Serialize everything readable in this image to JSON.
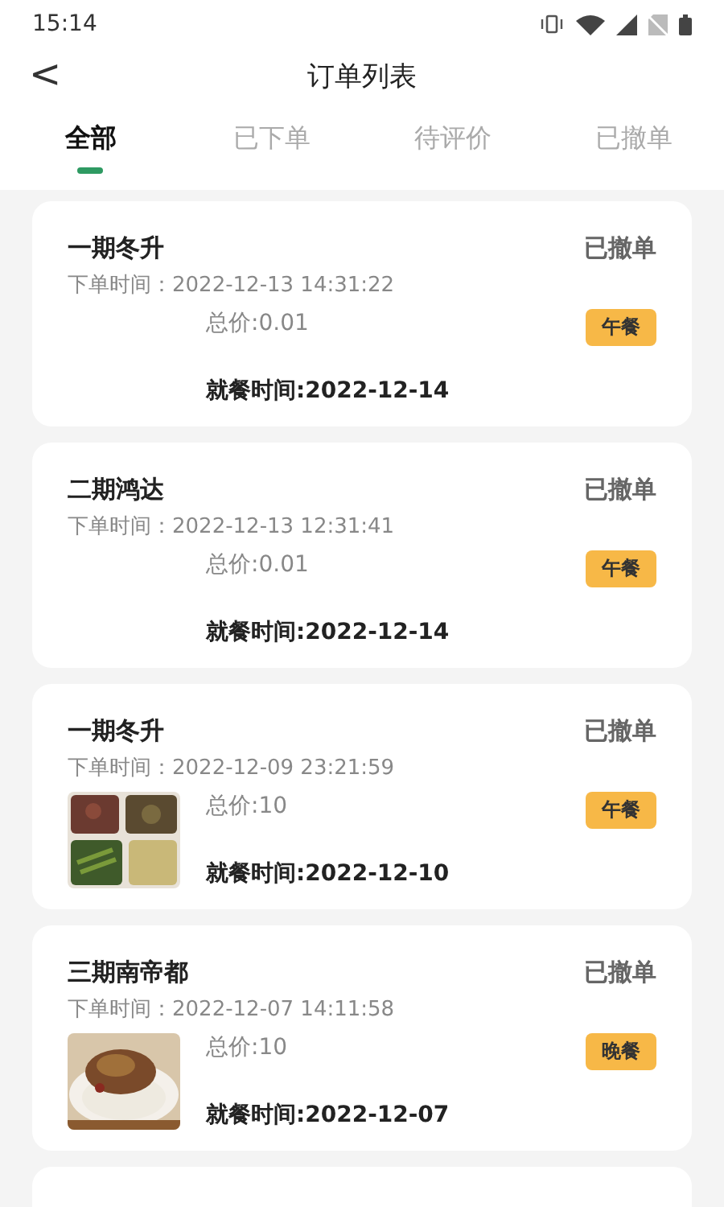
{
  "status_bar": {
    "time": "15:14"
  },
  "header": {
    "back": "<",
    "title": "订单列表"
  },
  "tabs": [
    {
      "label": "全部",
      "selected": true
    },
    {
      "label": "已下单",
      "selected": false
    },
    {
      "label": "待评价",
      "selected": false
    },
    {
      "label": "已撤单",
      "selected": false
    }
  ],
  "orders": [
    {
      "canteen": "一期冬升",
      "status": "已撤单",
      "order_time": "下单时间：2022-12-13 14:31:22",
      "price": "总价:0.01",
      "meal": "午餐",
      "dining_time": "就餐时间:2022-12-14"
    },
    {
      "canteen": "二期鸿达",
      "status": "已撤单",
      "order_time": "下单时间：2022-12-13 12:31:41",
      "price": "总价:0.01",
      "meal": "午餐",
      "dining_time": "就餐时间:2022-12-14"
    },
    {
      "canteen": "一期冬升",
      "status": "已撤单",
      "order_time": "下单时间：2022-12-09 23:21:59",
      "price": "总价:10",
      "meal": "午餐",
      "dining_time": "就餐时间:2022-12-10"
    },
    {
      "canteen": "三期南帝都",
      "status": "已撤单",
      "order_time": "下单时间：2022-12-07 14:11:58",
      "price": "总价:10",
      "meal": "晚餐",
      "dining_time": "就餐时间:2022-12-07"
    }
  ]
}
